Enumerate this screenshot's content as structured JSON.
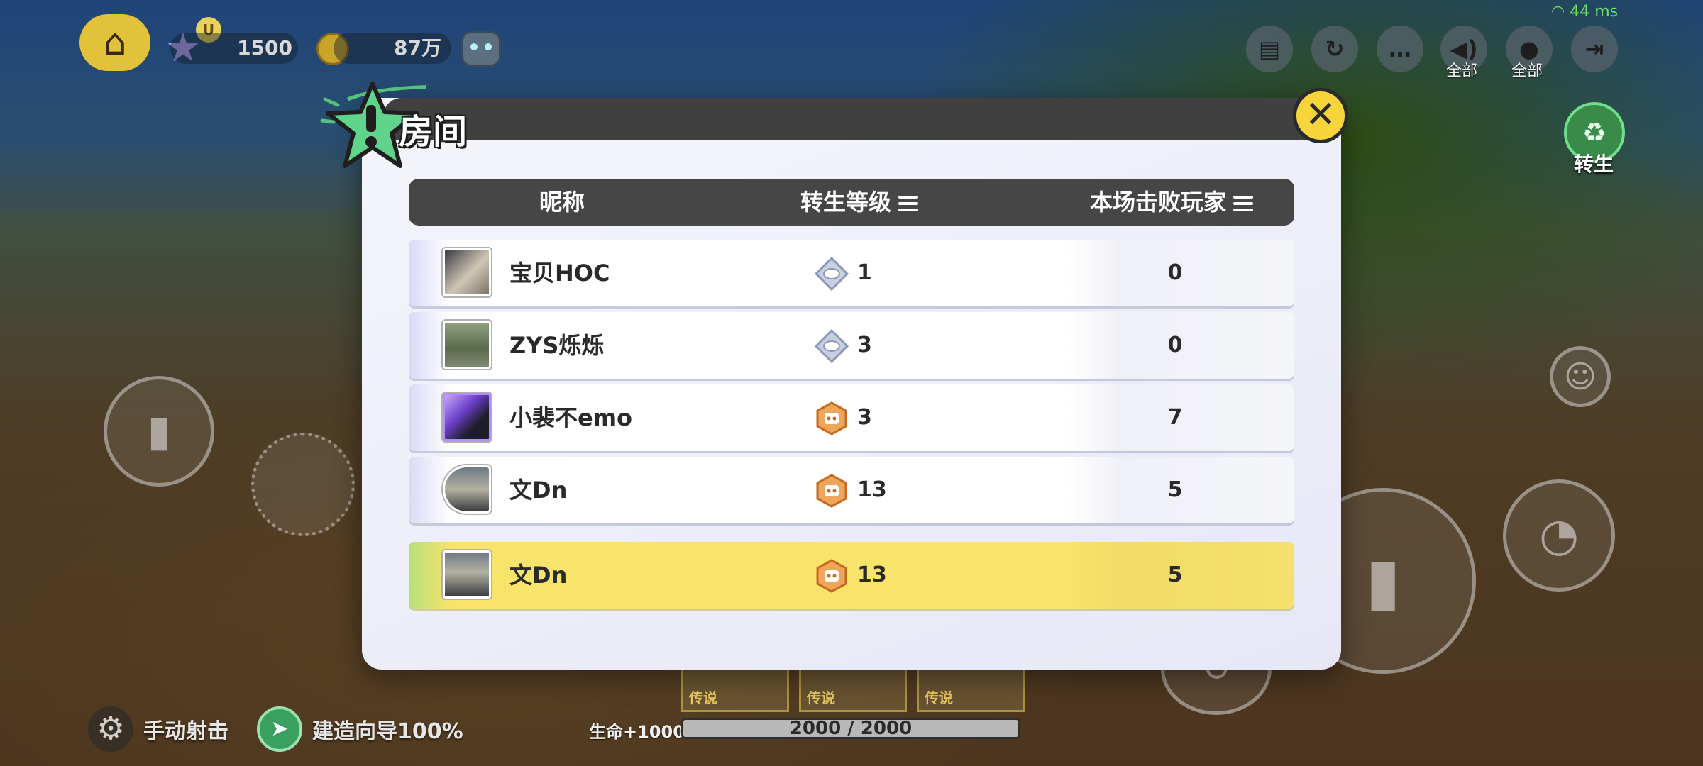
{
  "hud": {
    "star_badge": "U",
    "star_count": "1500",
    "coin_count": "87万",
    "ping": "44 ms",
    "voice_speaker_label": "全部",
    "voice_mic_label": "全部",
    "rebirth_label": "转生"
  },
  "room": {
    "title": "房间",
    "columns": {
      "nickname": "昵称",
      "rebirth_level": "转生等级",
      "kills": "本场击败玩家"
    },
    "players": [
      {
        "name": "宝贝HOC",
        "level": "1",
        "kills": "0",
        "rank_color": "#c7cfe0"
      },
      {
        "name": "ZYS烁烁",
        "level": "3",
        "kills": "0",
        "rank_color": "#c7cfe0"
      },
      {
        "name": "小裴不emo",
        "level": "3",
        "kills": "7",
        "rank_color": "#f0a65a"
      },
      {
        "name": "文Dn",
        "level": "13",
        "kills": "5",
        "rank_color": "#f0a65a"
      }
    ],
    "self": {
      "name": "文Dn",
      "level": "13",
      "kills": "5",
      "rank_color": "#f0a65a"
    }
  },
  "bottom": {
    "manual_fire": "手动射击",
    "build_guide": "建造向导100%",
    "weapon_tags": [
      "传说",
      "传说",
      "传说"
    ],
    "hp_bonus": "生命+1000",
    "hp_text": "2000 / 2000",
    "hp_fraction": 1.0
  },
  "colors": {
    "accent_yellow": "#f8e46a",
    "header_dark": "#464646",
    "rebirth_green": "#3a8a4a"
  }
}
